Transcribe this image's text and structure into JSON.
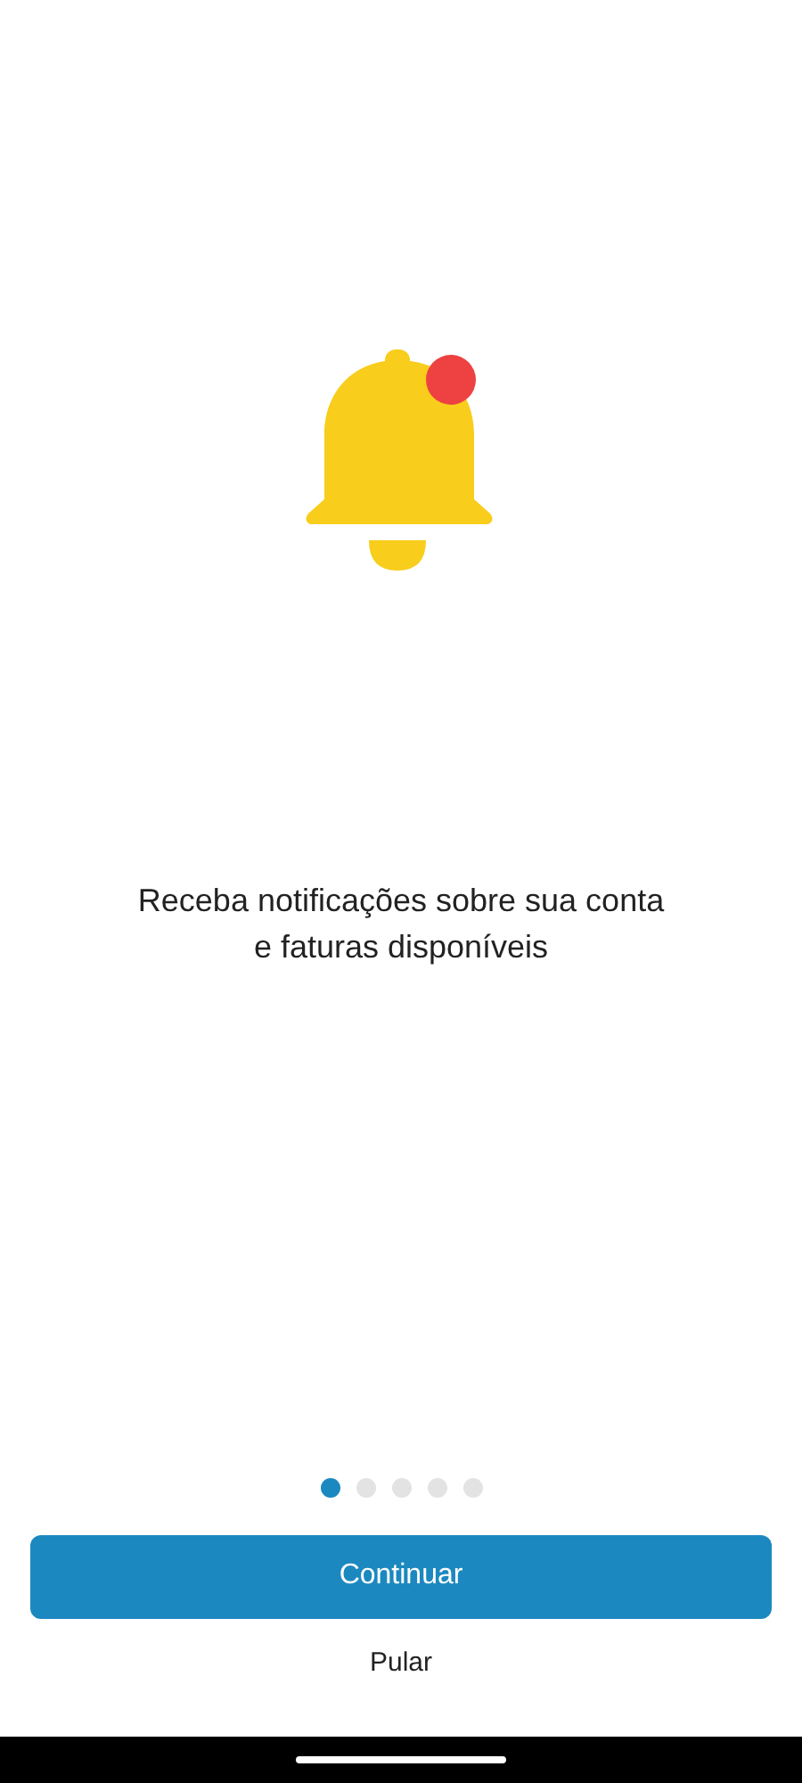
{
  "message": "Receba notificações sobre sua conta e faturas disponíveis",
  "pagination": [
    {
      "selected": true
    },
    {
      "selected": false
    },
    {
      "selected": false
    },
    {
      "selected": false
    },
    {
      "selected": false
    }
  ],
  "primary_button": "Continuar",
  "skip_link": "Pular"
}
